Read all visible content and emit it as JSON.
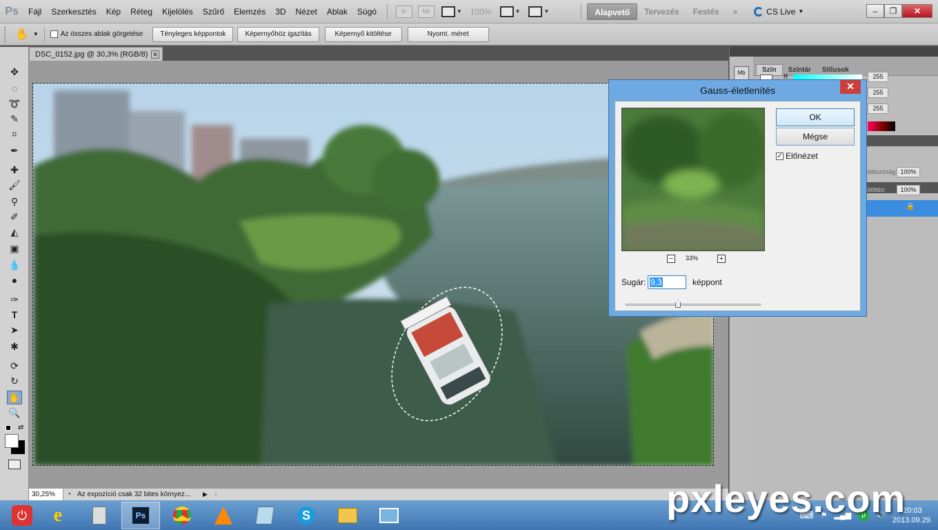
{
  "app": {
    "logo": "Ps"
  },
  "menu": [
    "Fájl",
    "Szerkesztés",
    "Kép",
    "Réteg",
    "Kijelölés",
    "Szűrő",
    "Elemzés",
    "3D",
    "Nézet",
    "Ablak",
    "Súgó"
  ],
  "menubar": {
    "br_label": "Br",
    "mb_label": "Mb",
    "zoom": "100%"
  },
  "workspaces": [
    "Alapvető",
    "Tervezés",
    "Festés"
  ],
  "cslive": "CS Live",
  "options": {
    "scroll_all_label": "Az összes ablak görgetése",
    "buttons": [
      "Tényleges képpontok",
      "Képernyőhöz igazítás",
      "Képernyő kitöltése",
      "Nyomt. méret"
    ]
  },
  "document": {
    "tab_title": "DSC_0152.jpg @ 30,3% (RGB/8)",
    "zoom": "30,25%",
    "status_msg": "Az expozíció csak 32 bites környez..."
  },
  "panels": {
    "tabs": [
      "Szín",
      "Színtár",
      "Stílusok"
    ],
    "r_label": "R",
    "values": [
      "255",
      "255",
      "255"
    ],
    "opacity_label": "Átlátszóság:",
    "opacity": "100%",
    "fill_label": "Kitöltés:",
    "fill": "100%"
  },
  "dialog": {
    "title": "Gauss-életlenítés",
    "ok": "OK",
    "cancel": "Mégse",
    "preview_label": "Előnézet",
    "zoom": "33%",
    "radius_label": "Sugár:",
    "radius_value": "9,3",
    "unit": "képpont"
  },
  "taskbar": {
    "time": "20:03",
    "date": "2013.09.29."
  },
  "watermark": "pxleyes.com"
}
